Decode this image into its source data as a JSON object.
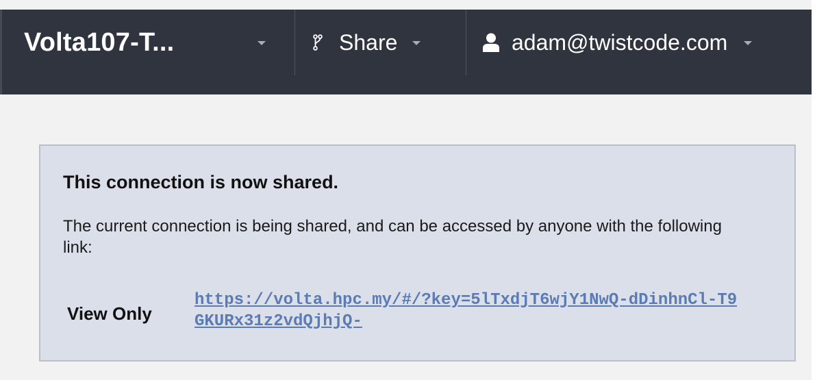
{
  "header": {
    "connection_title": "Volta107-T...",
    "share_label": "Share",
    "user_email": "adam@twistcode.com",
    "icons": {
      "share": "branch-icon",
      "user": "person-icon",
      "dropdown": "caret-down-icon"
    }
  },
  "notice": {
    "heading": "This connection is now shared.",
    "body": "The current connection is being shared, and can be accessed by anyone with the following link:",
    "access_level": "View Only",
    "share_url": "https://volta.hpc.my/#/?key=5lTxdjT6wjY1NwQ-dDinhnCl-T9GKURx31z2vdQjhjQ-"
  },
  "colors": {
    "topbar_bg": "#30343e",
    "notice_bg": "#dbdfe9",
    "notice_border": "#b9bec8",
    "link": "#5b7bb3",
    "page_bg": "#f2f2f2"
  }
}
